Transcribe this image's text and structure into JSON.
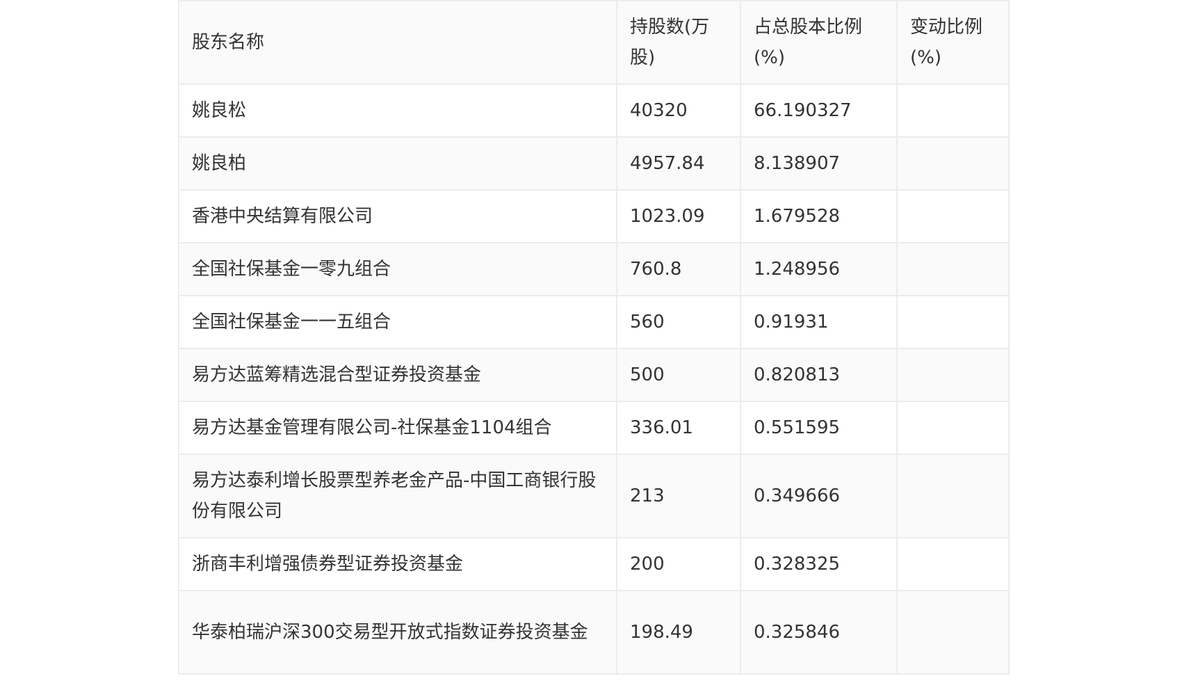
{
  "table": {
    "headers": [
      "股东名称",
      "持股数(万股)",
      "占总股本比例(%)",
      "变动比例(%)"
    ],
    "rows": [
      [
        "姚良松",
        "40320",
        "66.190327",
        ""
      ],
      [
        "姚良柏",
        "4957.84",
        "8.138907",
        ""
      ],
      [
        "香港中央结算有限公司",
        "1023.09",
        "1.679528",
        ""
      ],
      [
        "全国社保基金一零九组合",
        "760.8",
        "1.248956",
        ""
      ],
      [
        "全国社保基金一一五组合",
        "560",
        "0.91931",
        ""
      ],
      [
        "易方达蓝筹精选混合型证券投资基金",
        "500",
        "0.820813",
        ""
      ],
      [
        "易方达基金管理有限公司-社保基金1104组合",
        "336.01",
        "0.551595",
        ""
      ],
      [
        "易方达泰利增长股票型养老金产品-中国工商银行股份有限公司",
        "213",
        "0.349666",
        ""
      ],
      [
        "浙商丰利增强债券型证券投资基金",
        "200",
        "0.328325",
        ""
      ],
      [
        "华泰柏瑞沪深300交易型开放式指数证券投资基金",
        "198.49",
        "0.325846",
        ""
      ]
    ]
  }
}
